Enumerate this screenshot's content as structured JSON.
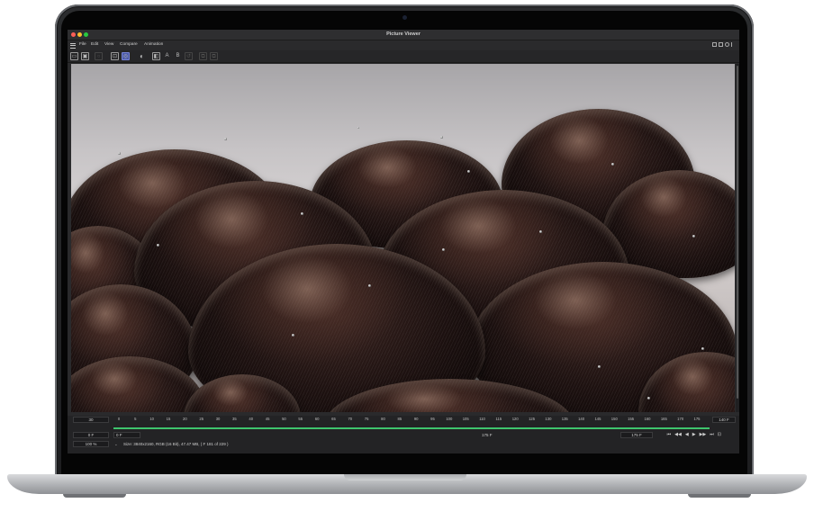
{
  "window": {
    "title": "Picture Viewer"
  },
  "menu": [
    "File",
    "Edit",
    "View",
    "Compare",
    "Animation"
  ],
  "toolbar": {
    "label_a": "A",
    "label_b": "B"
  },
  "timeline": {
    "fps": "30",
    "ticks": [
      "0",
      "5",
      "10",
      "15",
      "20",
      "25",
      "30",
      "35",
      "40",
      "45",
      "50",
      "55",
      "60",
      "65",
      "70",
      "75",
      "80",
      "85",
      "90",
      "95",
      "100",
      "105",
      "110",
      "115",
      "120",
      "125",
      "130",
      "135",
      "140",
      "145",
      "150",
      "155",
      "160",
      "165",
      "170",
      "175"
    ],
    "end_frame": "140 F",
    "current_frame": "0 F",
    "range_start": "0 F",
    "range_mid": "175 F",
    "range_end": "175 F",
    "zoom": "100 %",
    "status": "Size: 3840x2160, RGB (16 Bit), 47.47 MB,  ( F 181 of 229 )"
  },
  "colors": {
    "accent": "#4b5aa8",
    "timeline_green": "#3ec46d"
  }
}
